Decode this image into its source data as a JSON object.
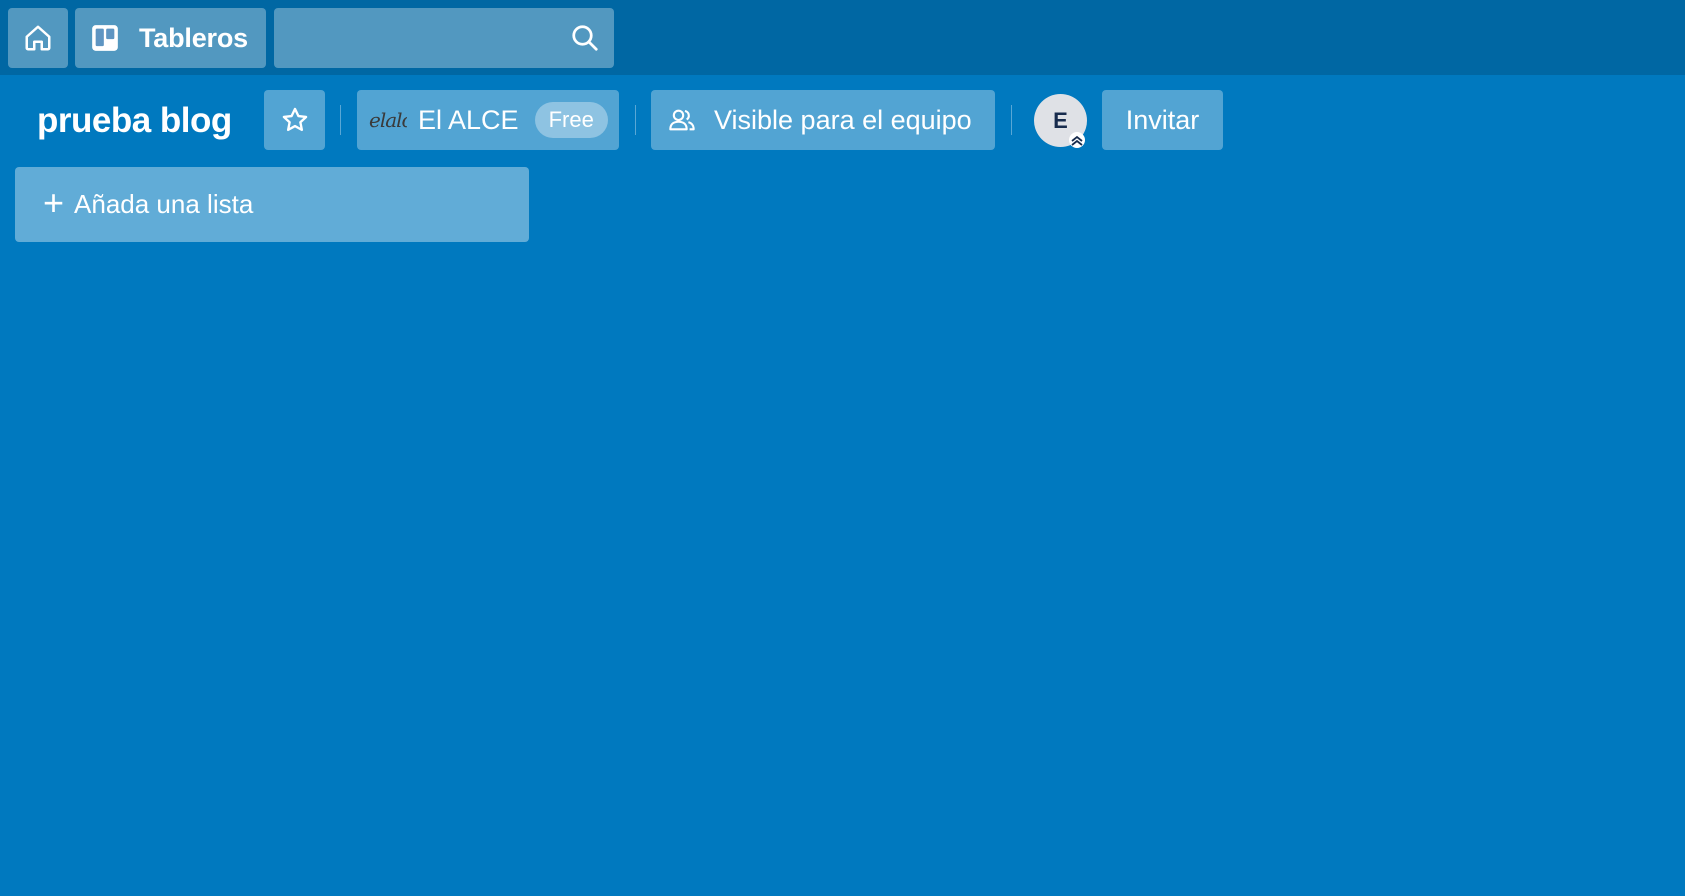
{
  "colors": {
    "board_background": "#0079bf",
    "topbar_background": "#0067a3",
    "avatar_background": "#dfe1e6",
    "avatar_text": "#172b4d"
  },
  "topbar": {
    "home_icon": "home-icon",
    "boards_icon": "boards-icon",
    "boards_label": "Tableros",
    "search": {
      "value": "",
      "icon": "search-icon"
    }
  },
  "board": {
    "title": "prueba blog",
    "star_icon": "star-icon",
    "team": {
      "logo_text": "elalce",
      "name": "El ALCE",
      "plan_badge": "Free"
    },
    "visibility": {
      "icon": "team-visibility-icon",
      "label": "Visible para el equipo"
    },
    "member": {
      "initial": "E",
      "admin_icon": "admin-chevron-icon"
    },
    "invite_label": "Invitar"
  },
  "lists": {
    "add_list_label": "Añada una lista",
    "add_icon": "plus-icon"
  }
}
